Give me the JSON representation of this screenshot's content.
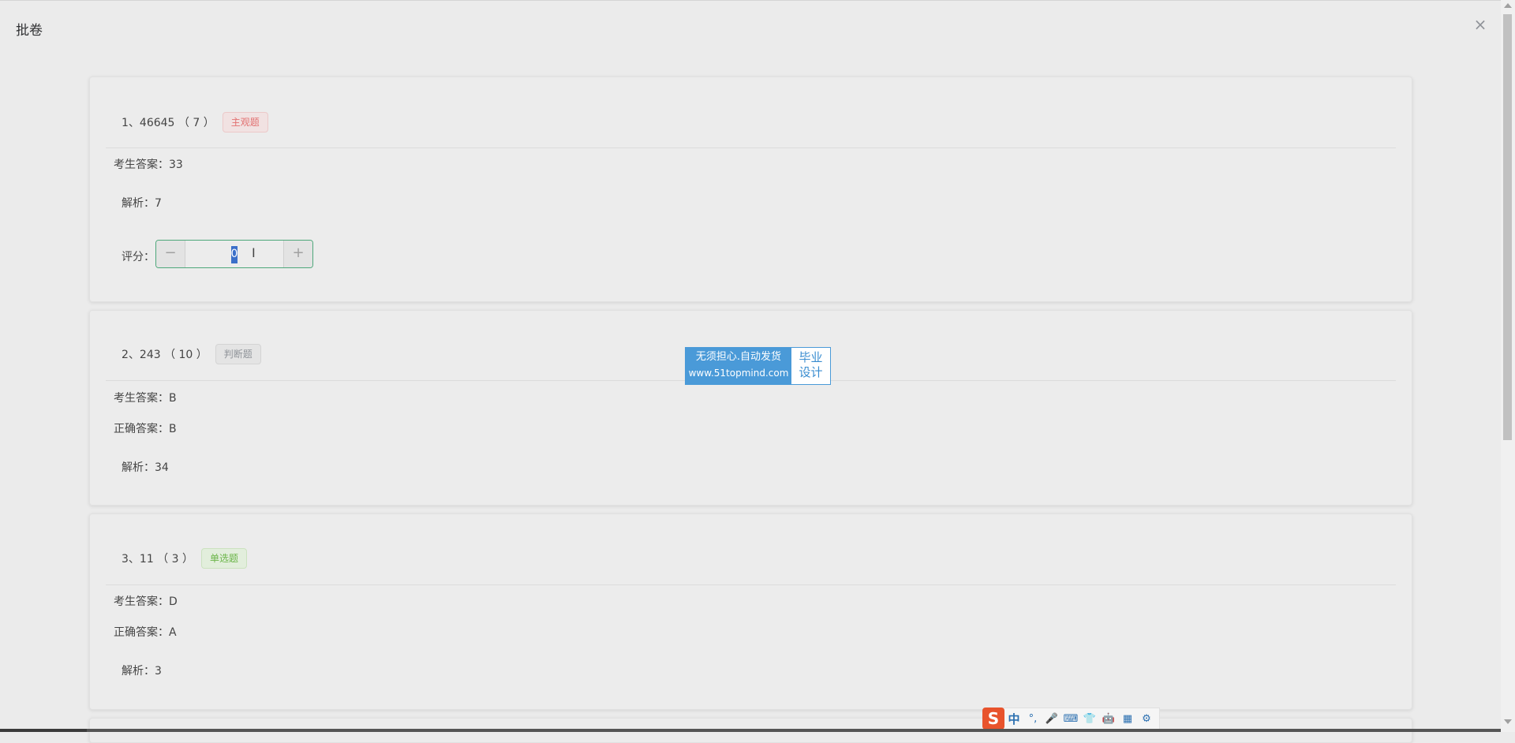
{
  "dialog": {
    "title": "批卷",
    "close_symbol": "×"
  },
  "questions": [
    {
      "header": "1、46645 （ 7 ）",
      "tag": "主观题",
      "student_answer_label": "考生答案：",
      "student_answer": "33",
      "analysis_label": "解析：",
      "analysis": "7",
      "score_label": "评分：",
      "score_value": "0"
    },
    {
      "header": "2、243 （ 10 ）",
      "tag": "判断题",
      "student_answer_label": "考生答案：",
      "student_answer": "B",
      "correct_answer_label": "正确答案：",
      "correct_answer": "B",
      "analysis_label": "解析：",
      "analysis": "34"
    },
    {
      "header": "3、11 （ 3 ）",
      "tag": "单选题",
      "student_answer_label": "考生答案：",
      "student_answer": "D",
      "correct_answer_label": "正确答案：",
      "correct_answer": "A",
      "analysis_label": "解析：",
      "analysis": "3"
    }
  ],
  "stepper": {
    "minus": "−",
    "plus": "+",
    "caret": "I"
  },
  "watermark": {
    "line1": "无须担心.自动发货",
    "line2": "www.51topmind.com",
    "side1": "毕业",
    "side2": "设计"
  },
  "ime": {
    "logo": "S",
    "items": [
      "中",
      "°,",
      "🎤",
      "⌨",
      "👕",
      "🤖",
      "▦",
      "⚙"
    ]
  },
  "colors": {
    "accent": "#4ea87a",
    "tag_red": "#e27171",
    "tag_gray": "#8f9399",
    "tag_green": "#6ab548",
    "watermark_blue": "#4a9ad8"
  }
}
